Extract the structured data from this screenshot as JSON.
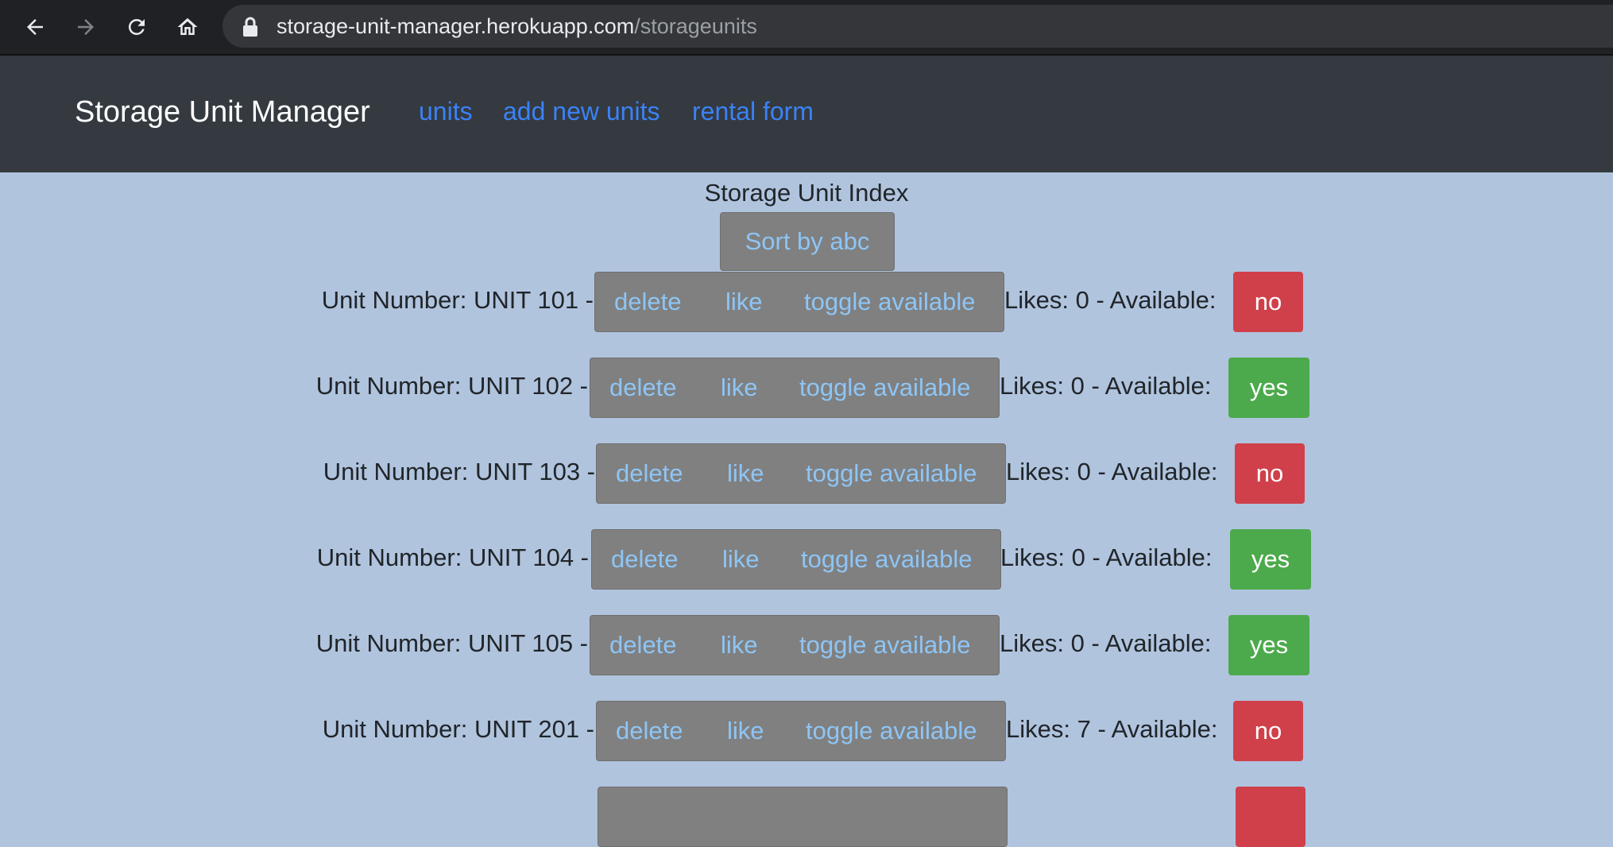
{
  "browser": {
    "url_host": "storage-unit-manager.herokuapp.com",
    "url_path": "/storageunits",
    "icons": [
      "back-arrow-icon",
      "forward-arrow-icon",
      "reload-icon",
      "home-icon",
      "lock-icon"
    ]
  },
  "navbar": {
    "brand": "Storage Unit Manager",
    "links": [
      "units",
      "add new units",
      "rental form"
    ]
  },
  "main": {
    "title": "Storage Unit Index",
    "sort_label": "Sort by abc",
    "buttons": {
      "delete": "delete",
      "like": "like",
      "toggle": "toggle available"
    },
    "units": [
      {
        "label": "Unit Number: UNIT 101 -",
        "stats": "Likes: 0 - Available:",
        "available": "no"
      },
      {
        "label": "Unit Number: UNIT 102 -",
        "stats": "Likes: 0 - Available:",
        "available": "yes"
      },
      {
        "label": "Unit Number: UNIT 103 -",
        "stats": "Likes: 0 - Available:",
        "available": "no"
      },
      {
        "label": "Unit Number: UNIT 104 -",
        "stats": "Likes: 0 - Available:",
        "available": "yes"
      },
      {
        "label": "Unit Number: UNIT 105 -",
        "stats": "Likes: 0 - Available:",
        "available": "yes"
      },
      {
        "label": "Unit Number: UNIT 201 -",
        "stats": "Likes: 7 - Available:",
        "available": "no"
      }
    ]
  },
  "colors": {
    "page_background": "#b0c4de",
    "navbar_background": "#343a40",
    "link_color": "#3b82f6",
    "button_gray": "#808080",
    "button_text": "#8ec5f5",
    "available_no": "#d0404a",
    "available_yes": "#4caa4c"
  }
}
